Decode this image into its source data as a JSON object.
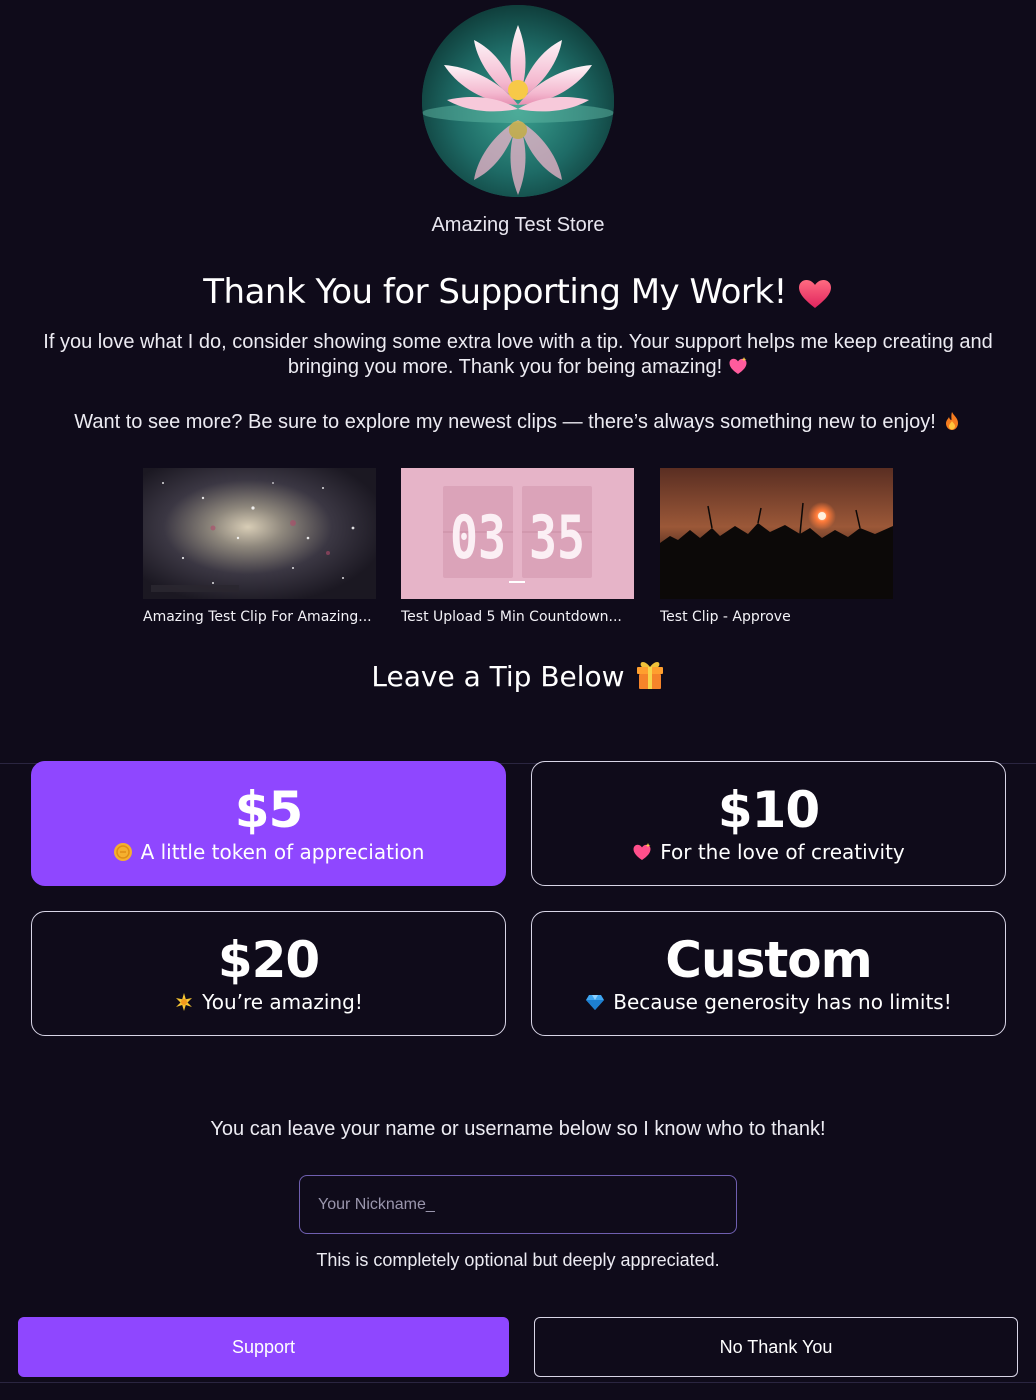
{
  "store": {
    "name": "Amazing Test Store"
  },
  "header": {
    "title": "Thank You for Supporting My Work!",
    "intro": "If you love what I do, consider showing some extra love with a tip. Your support helps me keep creating and bringing you more. Thank you for being amazing!",
    "explore": "Want to see more? Be sure to explore my newest clips — there’s always something new to enjoy!"
  },
  "clips": [
    {
      "title": "Amazing Test Clip For Amazing...",
      "thumbnail": "galaxy-thumbnail"
    },
    {
      "title": "Test Upload 5 Min Countdown...",
      "thumbnail": "countdown-thumbnail",
      "countdown_digits": [
        "03",
        "35"
      ]
    },
    {
      "title": "Test Clip - Approve",
      "thumbnail": "sunset-thumbnail"
    }
  ],
  "tips": {
    "title": "Leave a Tip Below",
    "options": [
      {
        "amount": "$5",
        "label": "A little token of appreciation",
        "icon": "coin-icon",
        "selected": true
      },
      {
        "amount": "$10",
        "label": "For the love of creativity",
        "icon": "sparkling-heart-icon",
        "selected": false
      },
      {
        "amount": "$20",
        "label": "You’re amazing!",
        "icon": "sparkle-star-icon",
        "selected": false
      },
      {
        "amount": "Custom",
        "label": "Because generosity has no limits!",
        "icon": "gem-icon",
        "selected": false
      }
    ]
  },
  "nickname": {
    "prompt": "You can leave your name or username below so I know who to thank!",
    "placeholder": "Your Nickname_",
    "value": "",
    "note": "This is completely optional but deeply appreciated."
  },
  "actions": {
    "support_label": "Support",
    "decline_label": "No Thank You"
  },
  "colors": {
    "background": "#0f0b1a",
    "accent": "#8f47ff",
    "border": "#d8d5e6"
  }
}
